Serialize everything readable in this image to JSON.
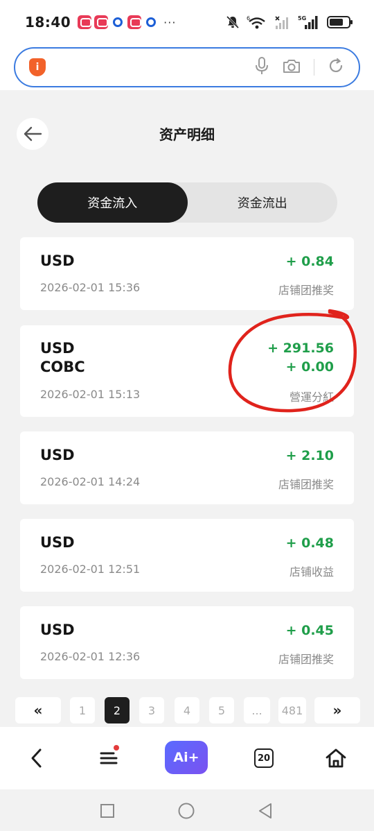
{
  "status_bar": {
    "time": "18:40",
    "icons": [
      "app-notification-icon",
      "app-notification-icon",
      "circle-app-icon",
      "app-notification-icon",
      "circle-app-icon"
    ],
    "more": "···",
    "signal_labels": [
      "6",
      "5G"
    ]
  },
  "browser": {
    "address_value": "",
    "icons": [
      "shield-icon",
      "microphone-icon",
      "camera-icon",
      "refresh-icon"
    ]
  },
  "header": {
    "title": "资产明细"
  },
  "tabs": [
    {
      "label": "资金流入",
      "active": true
    },
    {
      "label": "资金流出",
      "active": false
    }
  ],
  "records": [
    {
      "currencies": [
        "USD"
      ],
      "amounts": [
        "+ 0.84"
      ],
      "datetime": "2026-02-01 15:36",
      "type": "店铺团推奖"
    },
    {
      "currencies": [
        "USD",
        "COBC"
      ],
      "amounts": [
        "+ 291.56",
        "+ 0.00"
      ],
      "datetime": "2026-02-01 15:13",
      "type": "營運分紅"
    },
    {
      "currencies": [
        "USD"
      ],
      "amounts": [
        "+ 2.10"
      ],
      "datetime": "2026-02-01 14:24",
      "type": "店铺团推奖"
    },
    {
      "currencies": [
        "USD"
      ],
      "amounts": [
        "+ 0.48"
      ],
      "datetime": "2026-02-01 12:51",
      "type": "店铺收益"
    },
    {
      "currencies": [
        "USD"
      ],
      "amounts": [
        "+ 0.45"
      ],
      "datetime": "2026-02-01 12:36",
      "type": "店铺团推奖"
    }
  ],
  "pagination": {
    "prev": "«",
    "pages": [
      "1",
      "2",
      "3",
      "4",
      "5",
      "...",
      "481"
    ],
    "current": "2",
    "next": "»"
  },
  "toolbar": {
    "ai_label": "Ai+",
    "tab_count": "20"
  },
  "colors": {
    "accent_dark": "#1e1e1e",
    "positive": "#1f9e4a",
    "address_border": "#3b7be0",
    "annotation": "#e0231c"
  }
}
